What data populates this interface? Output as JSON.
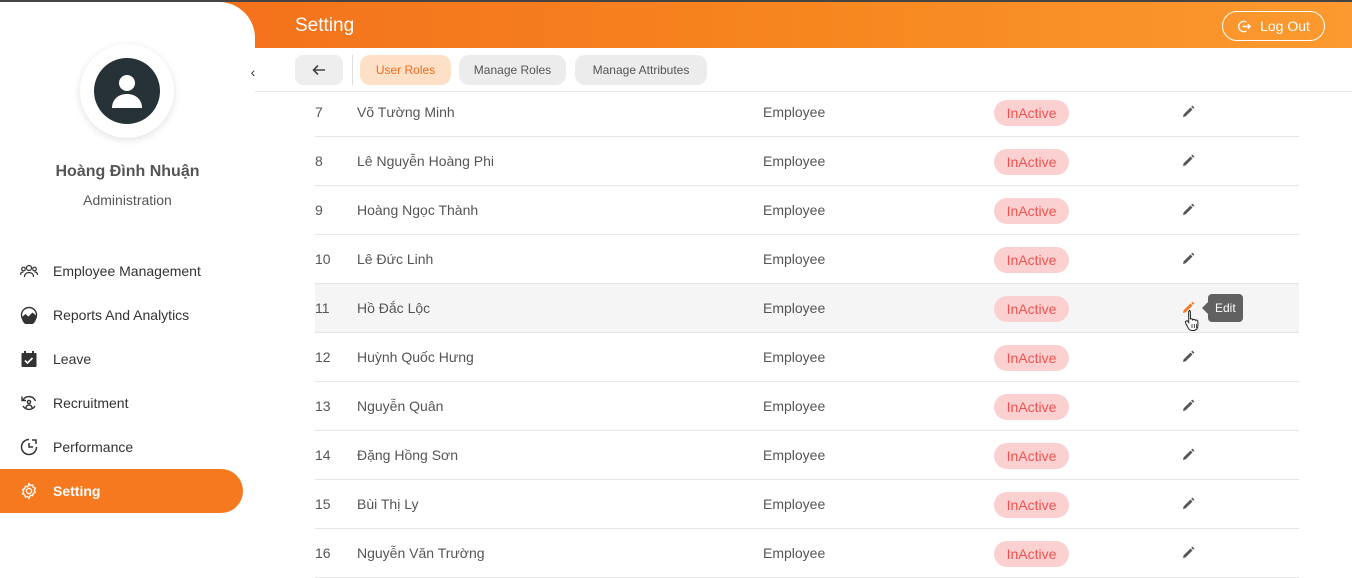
{
  "header": {
    "title": "Setting",
    "logout_label": "Log Out"
  },
  "profile": {
    "name": "Hoàng Đình Nhuận",
    "role": "Administration"
  },
  "sidebar": {
    "items": [
      {
        "label": "Employee Management",
        "icon": "people-icon"
      },
      {
        "label": "Reports And Analytics",
        "icon": "chart-icon"
      },
      {
        "label": "Leave",
        "icon": "calendar-check-icon"
      },
      {
        "label": "Recruitment",
        "icon": "recruit-icon"
      },
      {
        "label": "Performance",
        "icon": "performance-icon"
      },
      {
        "label": "Setting",
        "icon": "gear-icon",
        "active": true
      }
    ]
  },
  "tabs": {
    "user_roles": "User Roles",
    "manage_roles": "Manage Roles",
    "manage_attributes": "Manage Attributes"
  },
  "table": {
    "rows": [
      {
        "no": "7",
        "name": "Võ Tường Minh",
        "role": "Employee",
        "status": "InActive"
      },
      {
        "no": "8",
        "name": "Lê Nguyễn Hoàng Phi",
        "role": "Employee",
        "status": "InActive"
      },
      {
        "no": "9",
        "name": "Hoàng Ngọc Thành",
        "role": "Employee",
        "status": "InActive"
      },
      {
        "no": "10",
        "name": "Lê Đức Linh",
        "role": "Employee",
        "status": "InActive"
      },
      {
        "no": "11",
        "name": "Hồ Đắc Lộc",
        "role": "Employee",
        "status": "InActive"
      },
      {
        "no": "12",
        "name": "Huỳnh Quốc Hưng",
        "role": "Employee",
        "status": "InActive"
      },
      {
        "no": "13",
        "name": "Nguyễn Quân",
        "role": "Employee",
        "status": "InActive"
      },
      {
        "no": "14",
        "name": "Đặng Hồng Sơn",
        "role": "Employee",
        "status": "InActive"
      },
      {
        "no": "15",
        "name": "Bùi Thị Ly",
        "role": "Employee",
        "status": "InActive"
      },
      {
        "no": "16",
        "name": "Nguyễn Văn Trường",
        "role": "Employee",
        "status": "InActive"
      }
    ]
  },
  "tooltip": {
    "text": "Edit"
  },
  "colors": {
    "accent": "#f7791f",
    "status_bg": "#fbd0d0",
    "status_text": "#ef5350",
    "tab_active_bg": "#fde0c6"
  }
}
